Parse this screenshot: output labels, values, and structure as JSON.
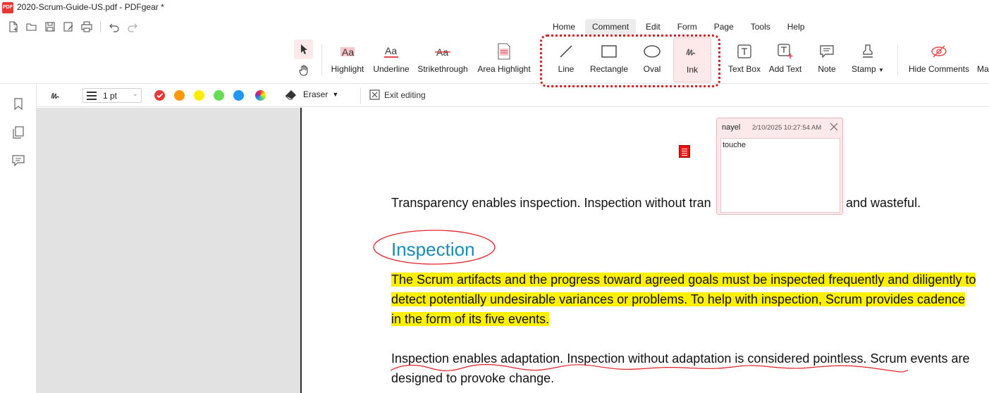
{
  "window": {
    "title": "2020-Scrum-Guide-US.pdf - PDFgear *",
    "logo_text": "PDF"
  },
  "quick_access": {
    "icons": [
      "new-file-icon",
      "open-folder-icon",
      "save-icon",
      "save-as-icon",
      "print-icon",
      "undo-icon",
      "redo-icon"
    ]
  },
  "menu": {
    "items": [
      "Home",
      "Comment",
      "Edit",
      "Form",
      "Page",
      "Tools",
      "Help"
    ],
    "active": "Comment"
  },
  "ribbon": {
    "tools": [
      {
        "label": "Highlight",
        "icon": "highlight-icon"
      },
      {
        "label": "Underline",
        "icon": "underline-icon"
      },
      {
        "label": "Strikethrough",
        "icon": "strikethrough-icon"
      },
      {
        "label": "Area Highlight",
        "icon": "area-highlight-icon"
      },
      {
        "label": "Line",
        "icon": "line-icon"
      },
      {
        "label": "Rectangle",
        "icon": "rectangle-icon"
      },
      {
        "label": "Oval",
        "icon": "oval-icon"
      },
      {
        "label": "Ink",
        "icon": "ink-icon",
        "active": true
      },
      {
        "label": "Text Box",
        "icon": "text-box-icon"
      },
      {
        "label": "Add Text",
        "icon": "add-text-icon"
      },
      {
        "label": "Note",
        "icon": "note-icon"
      },
      {
        "label": "Stamp",
        "icon": "stamp-icon",
        "dropdown": true
      },
      {
        "label": "Hide Comments",
        "icon": "hide-comments-icon"
      },
      {
        "label": "Ma",
        "icon": "more-icon"
      }
    ],
    "accent_color": "#e5484d",
    "callout_color": "#d62027"
  },
  "ink_toolbar": {
    "stroke_width": "1 pt",
    "colors": [
      "#e53935",
      "#ff9800",
      "#ffeb00",
      "#66dd55",
      "#2196f3",
      "multicolor"
    ],
    "selected_color": "#e53935",
    "eraser_label": "Eraser",
    "exit_label": "Exit editing"
  },
  "left_rail": {
    "icons": [
      "bookmark-icon",
      "pages-icon",
      "comments-icon"
    ]
  },
  "document": {
    "line1": "Transparency enables inspection. Inspection without tran",
    "line1_tail": "and wasteful.",
    "heading": "Inspection",
    "highlight_lines": [
      "The Scrum artifacts and the progress toward agreed goals must be inspected frequently and diligently to",
      "detect potentially undesirable variances or problems. To help with inspection, Scrum provides cadence",
      "in the form of its five events."
    ],
    "para2_line1": "Inspection enables adaptation. Inspection without adaptation is considered pointless. Scrum events are",
    "para2_line2": "designed to provoke change."
  },
  "comment_popup": {
    "author": "nayel",
    "timestamp": "2/10/2025 10:27:54 AM",
    "text": "touche"
  },
  "annotation_color": "#e0242b",
  "heading_color": "#1b8bb5",
  "highlight_color": "#fff000"
}
